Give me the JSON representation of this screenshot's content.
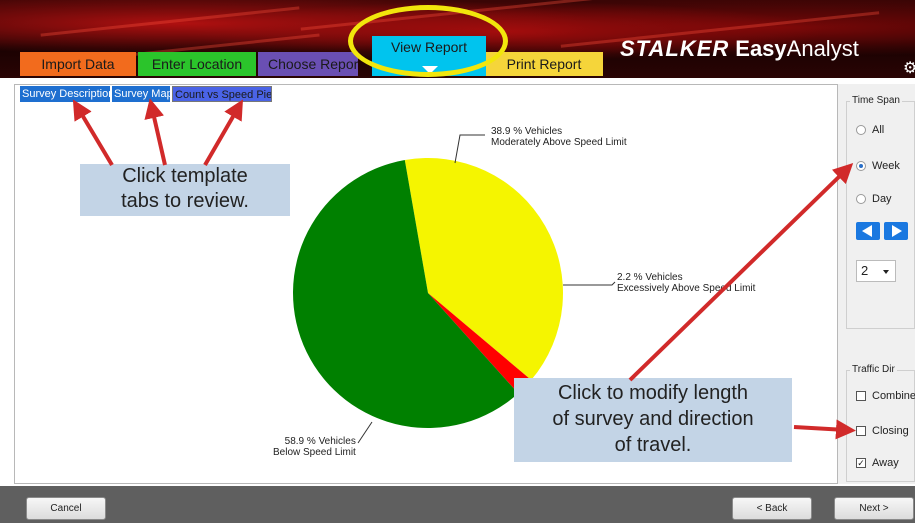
{
  "app": {
    "brand_stalker": "STALKER",
    "brand_easy": "Easy",
    "brand_analyst": "Analyst",
    "settings_icon": "gear-icon"
  },
  "main_tabs": {
    "import": "Import Data",
    "enter": "Enter Location",
    "choose": "Choose Report",
    "view": "View Report",
    "print": "Print Report"
  },
  "sub_tabs": {
    "desc": "Survey Description",
    "map": "Survey Map",
    "pie": "Count vs Speed Pie"
  },
  "callouts": {
    "tabs_line1": "Click template",
    "tabs_line2": "tabs to review.",
    "panel_line1": "Click to modify length",
    "panel_line2": "of survey and direction",
    "panel_line3": "of travel."
  },
  "time_span": {
    "title": "Time Span",
    "all": "All",
    "week": "Week",
    "day": "Day",
    "selected": "Week",
    "period_value": "2"
  },
  "traffic_dir": {
    "title": "Traffic Dir",
    "combined": "Combined",
    "closing": "Closing",
    "away": "Away",
    "combined_checked": false,
    "closing_checked": false,
    "away_checked": true
  },
  "footer": {
    "cancel": "Cancel",
    "back": "< Back",
    "next": "Next >"
  },
  "colors": {
    "moderate": "#f5f500",
    "excessive": "#ff0000",
    "below": "#008000",
    "arrow": "#d12a2a",
    "highlight": "#f2e60c"
  },
  "chart_data": {
    "type": "pie",
    "slices": [
      {
        "percent": 38.9,
        "label_line1": "38.9 %  Vehicles",
        "label_line2": "Moderately Above Speed Limit",
        "color": "#f5f500"
      },
      {
        "percent": 2.2,
        "label_line1": "2.2 %  Vehicles",
        "label_line2": "Excessively Above Speed Limit",
        "color": "#ff0000"
      },
      {
        "percent": 58.9,
        "label_line1": "58.9 %  Vehicles",
        "label_line2": "Below Speed Limit",
        "color": "#008000"
      }
    ]
  }
}
